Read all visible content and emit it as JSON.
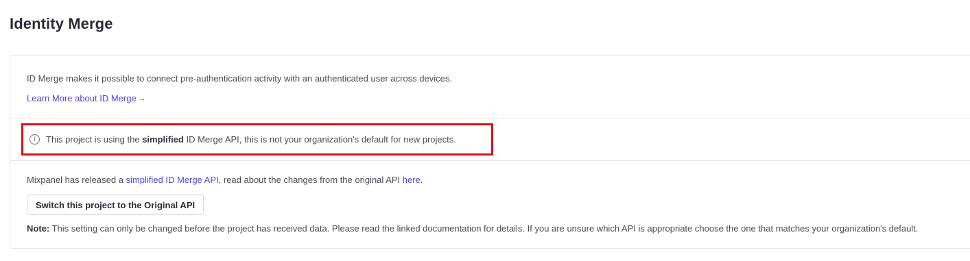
{
  "page": {
    "title": "Identity Merge"
  },
  "intro": {
    "description": "ID Merge makes it possible to connect pre-authentication activity with an authenticated user across devices.",
    "learn_more_label": "Learn More about ID Merge",
    "learn_more_arrow": "→"
  },
  "callout": {
    "icon": "info-icon",
    "icon_glyph": "i",
    "text_before": "This project is using the ",
    "text_bold": "simplified",
    "text_after": " ID Merge API, this is not your organization's default for new projects.",
    "highlight_color": "#d80e16"
  },
  "api_section": {
    "text_before": "Mixpanel has released a ",
    "simplified_link": "simplified ID Merge API",
    "text_middle": ", read about the changes from the original API ",
    "here_link": "here",
    "text_end": ".",
    "switch_button_label": "Switch this project to the Original API",
    "note_label": "Note:",
    "note_text": " This setting can only be changed before the project has received data. Please read the linked documentation for details. If you are unsure which API is appropriate choose the one that matches your organization's default."
  },
  "colors": {
    "link": "#4f44e0",
    "text": "#4a4a55",
    "heading": "#2b2b36"
  }
}
